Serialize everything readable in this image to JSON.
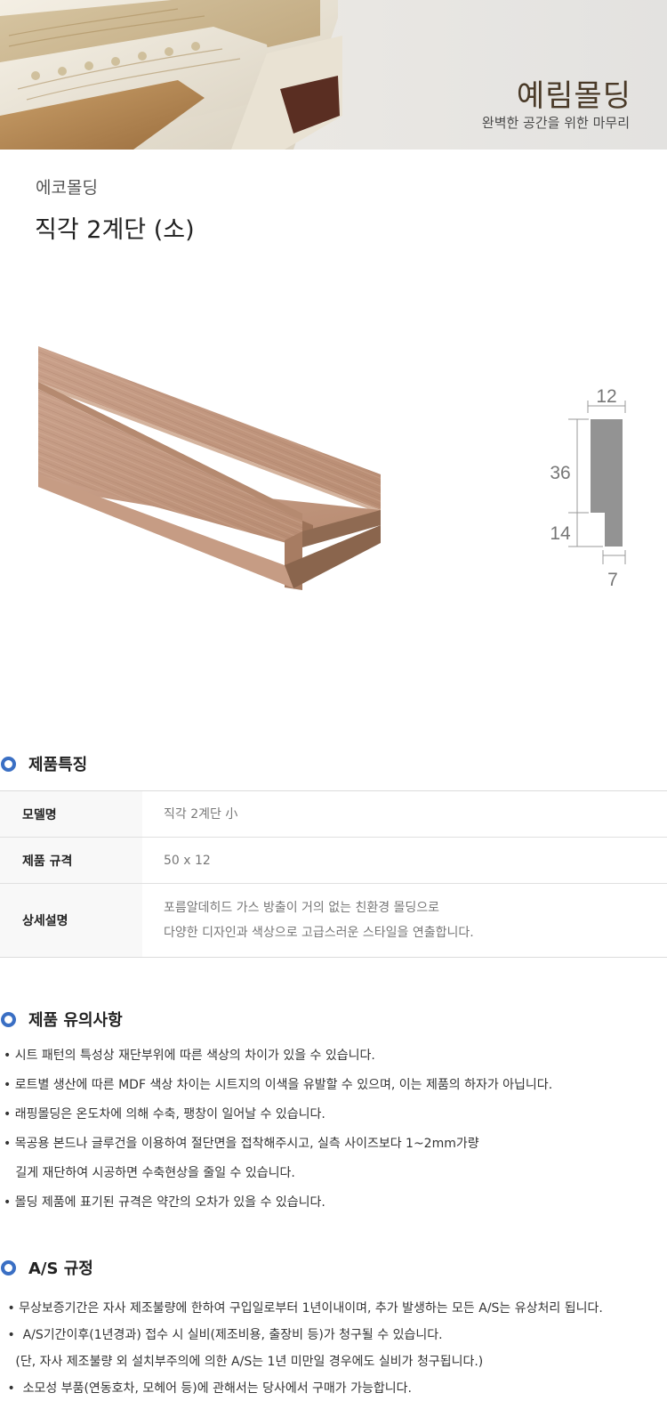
{
  "banner": {
    "brand_title": "예림몰딩",
    "brand_subtitle": "완벽한 공간을 위한 마무리"
  },
  "product": {
    "category": "에코몰딩",
    "title": "직각 2계단 (소)",
    "image_icon": "wood-molding-photo",
    "profile_dimensions": {
      "top_width": "12",
      "upper_height": "36",
      "lower_height": "14",
      "bottom_width": "7"
    }
  },
  "features": {
    "heading": "제품특징",
    "rows": [
      {
        "label": "모델명",
        "lines": [
          "직각 2계단 小"
        ]
      },
      {
        "label": "제품 규격",
        "lines": [
          "50 x 12"
        ]
      },
      {
        "label": "상세설명",
        "lines": [
          "포름알데히드 가스 방출이 거의 없는 친환경 몰딩으로",
          "다양한 디자인과 색상으로 고급스러운 스타일을 연출합니다."
        ]
      }
    ]
  },
  "cautions": {
    "heading": "제품 유의사항",
    "lines": [
      "• 시트 패턴의 특성상 재단부위에 따른 색상의 차이가 있을 수 있습니다.",
      "• 로트별 생산에 따른 MDF 색상 차이는 시트지의 이색을 유발할 수 있으며, 이는 제품의 하자가 아닙니다.",
      "• 래핑몰딩은 온도차에 의해 수축, 팽창이 일어날 수 있습니다.",
      "•  목공용 본드나 글루건을 이용하여 절단면을 접착해주시고, 실측 사이즈보다 1~2mm가량",
      "   길게 재단하여 시공하면 수축현상을 줄일 수 있습니다.",
      "•  몰딩 제품에 표기된 규격은 약간의 오차가 있을 수 있습니다."
    ]
  },
  "as_policy": {
    "heading": "A/S 규정",
    "lines": [
      " • 무상보증기간은 자사 제조불량에 한하여 구입일로부터 1년이내이며, 추가 발생하는 모든 A/S는 유상처리 됩니다.",
      " •  A/S기간이후(1년경과) 접수 시 실비(제조비용, 출장비 등)가 청구될 수 있습니다.",
      "   (단, 자사 제조불량 외 설치부주의에 의한 A/S는 1년 미만일 경우에도 실비가 청구됩니다.)",
      " •  소모성 부품(연동호차, 모헤어 등)에 관해서는 당사에서 구매가 가능합니다."
    ]
  },
  "colors": {
    "accent": "#3a6fc4",
    "wood": "#c29a7e",
    "profile_gray": "#939393"
  }
}
